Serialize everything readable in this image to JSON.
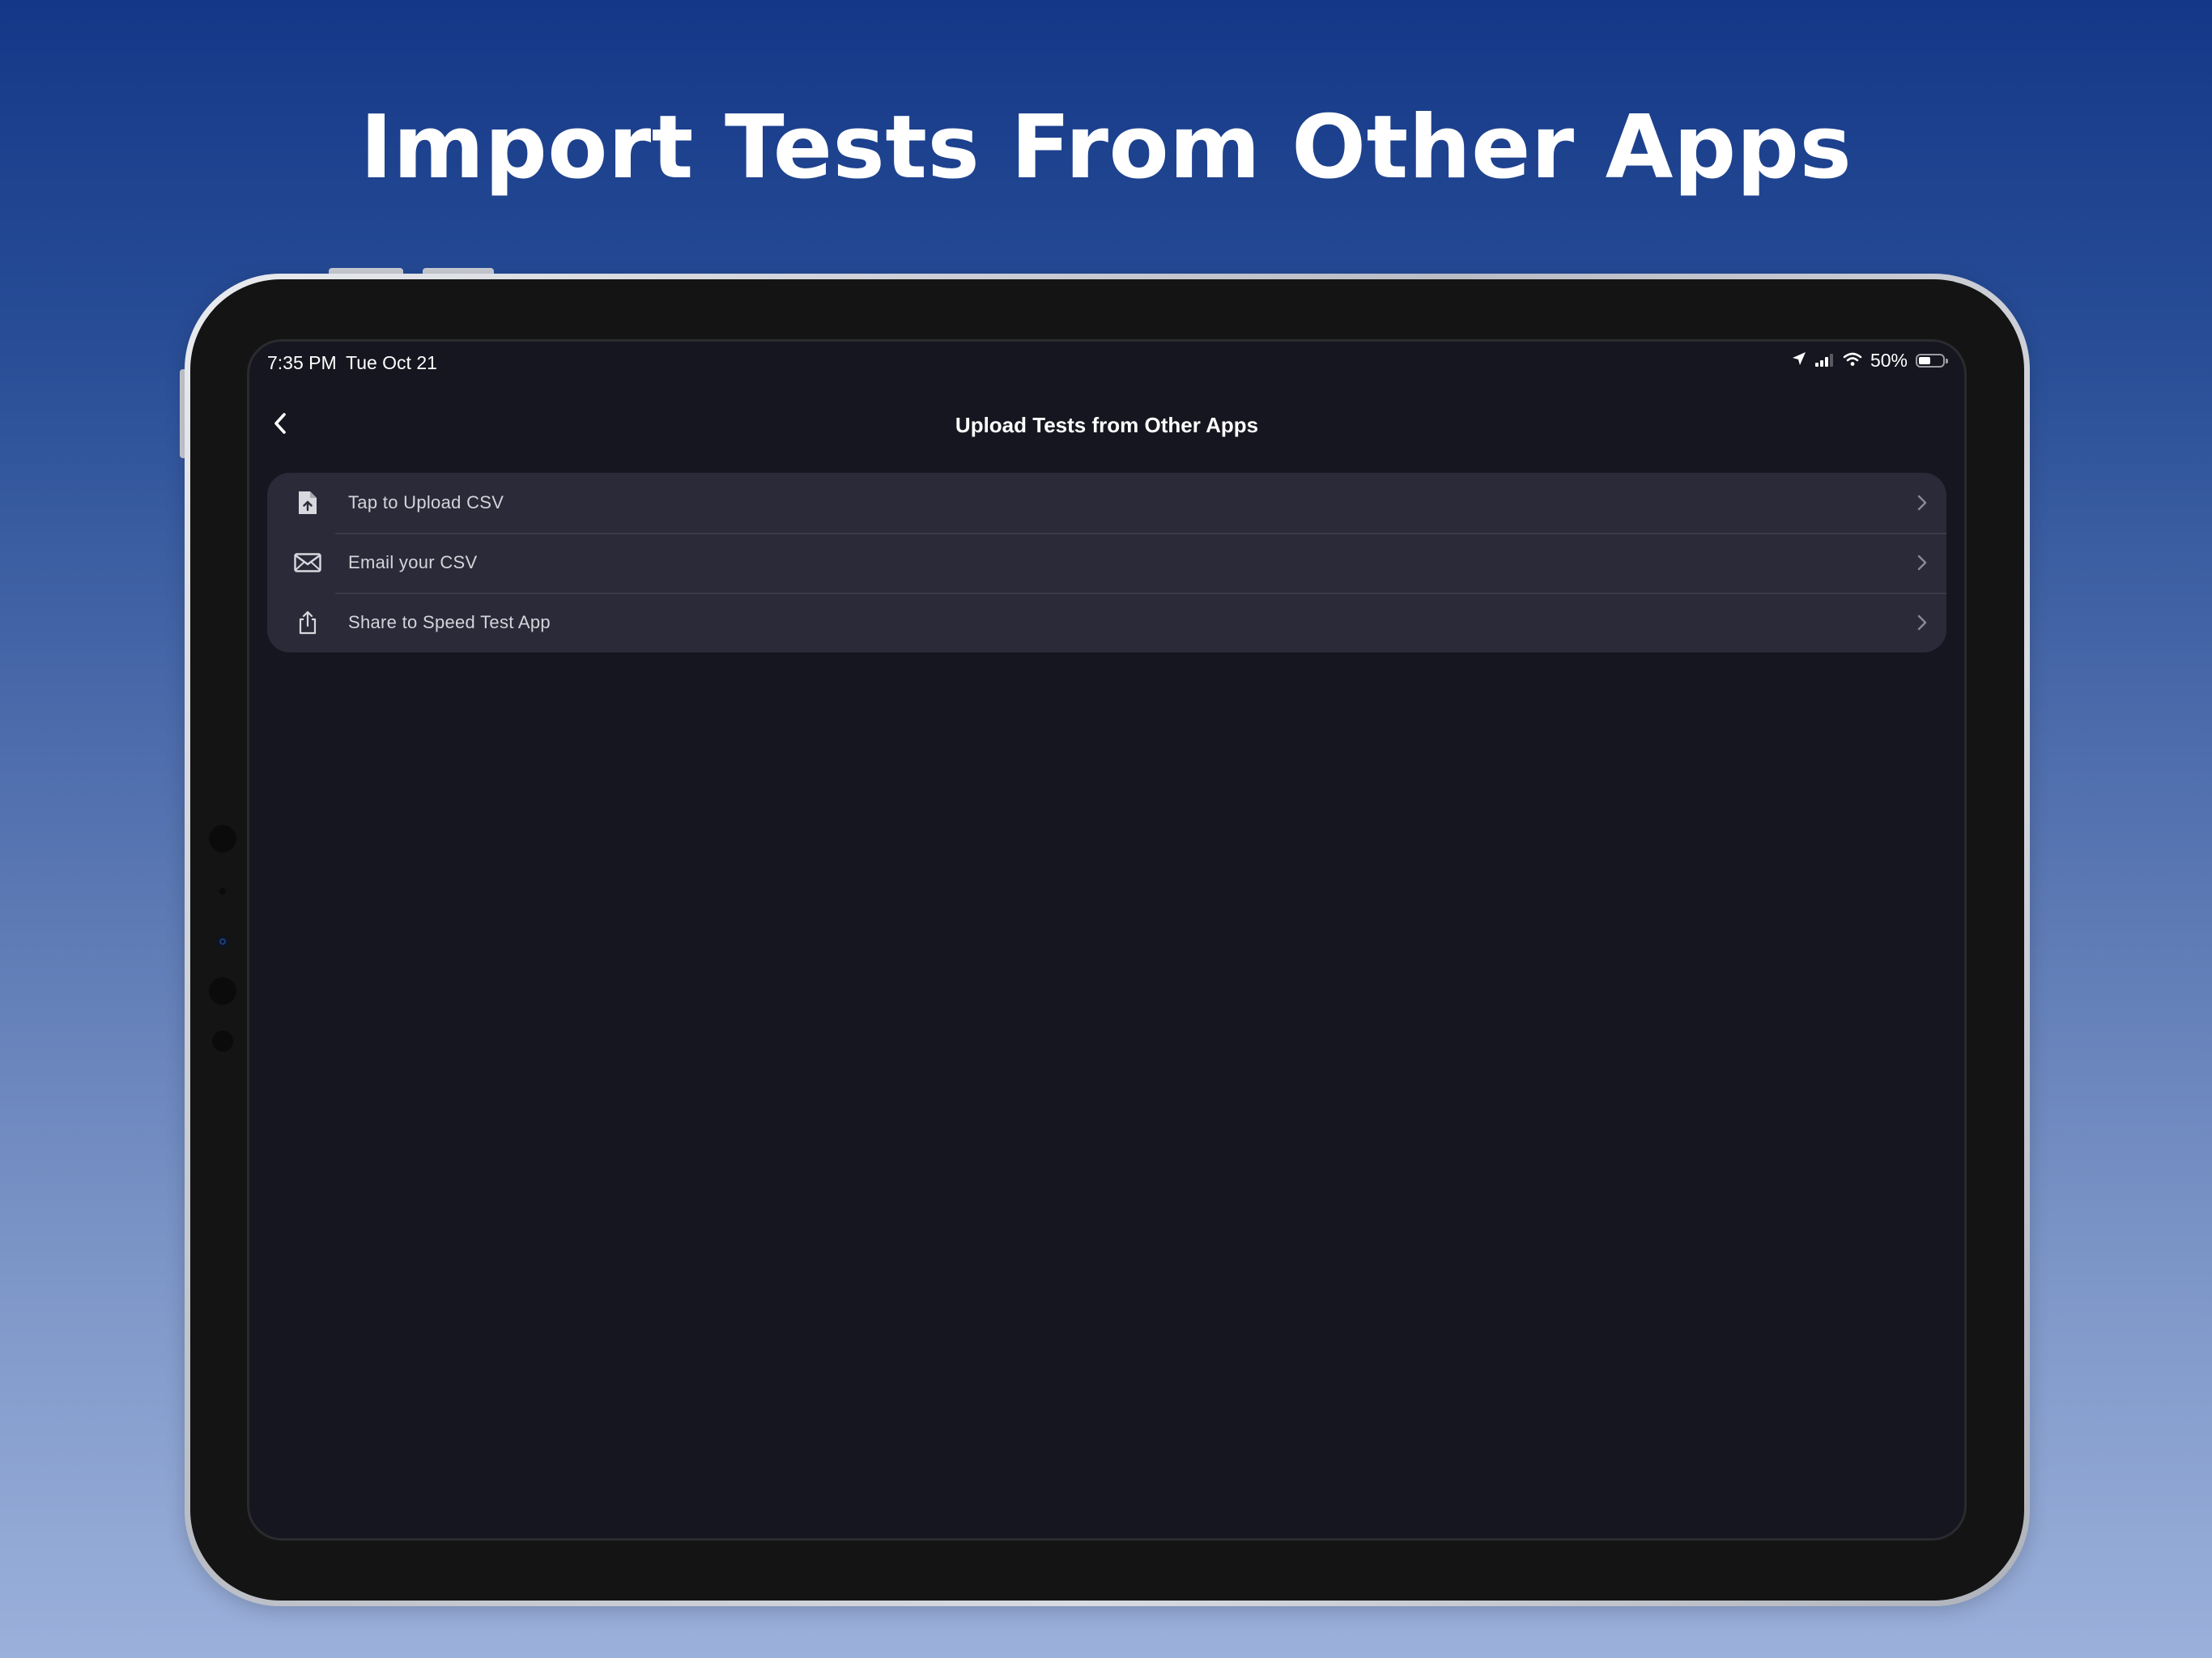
{
  "headline": "Import Tests From Other Apps",
  "status_bar": {
    "time": "7:35 PM",
    "date": "Tue Oct 21",
    "battery_percent": "50%",
    "battery_level": 0.5,
    "icons": [
      "location-arrow-icon",
      "cellular-signal-icon",
      "wifi-icon",
      "battery-icon"
    ]
  },
  "nav": {
    "title": "Upload Tests from Other Apps",
    "back_icon": "chevron-left-icon"
  },
  "options": [
    {
      "label": "Tap to Upload CSV",
      "icon": "file-upload-icon"
    },
    {
      "label": "Email your CSV",
      "icon": "envelope-icon"
    },
    {
      "label": "Share to Speed Test App",
      "icon": "share-icon"
    }
  ],
  "colors": {
    "screen_background": "#15161f",
    "list_background": "#2a2a39",
    "accent_text": "#ffffff"
  }
}
